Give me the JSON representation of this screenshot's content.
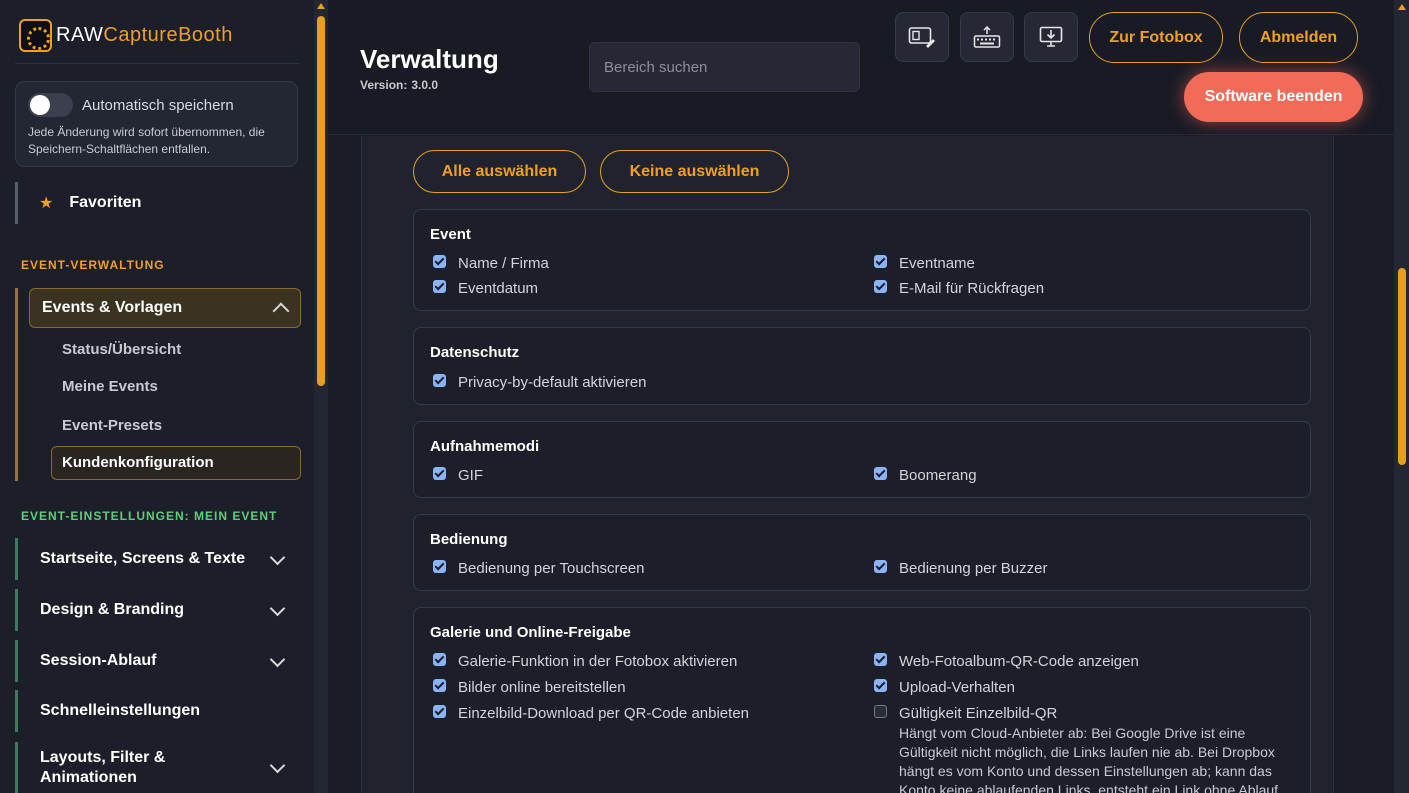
{
  "brand": {
    "raw": "RAW",
    "rest": "CaptureBooth",
    "accent": "#f0a020"
  },
  "autosave": {
    "label": "Automatisch speichern",
    "description": "Jede Änderung wird sofort übernommen, die Speichern-Schaltflächen entfallen.",
    "enabled": false
  },
  "favorites": {
    "label": "Favoriten",
    "icon": "star-icon"
  },
  "sidebar": {
    "section_event_management": "EVENT-VERWALTUNG",
    "events_group": {
      "label": "Events & Vorlagen",
      "items": [
        "Status/Übersicht",
        "Meine Events",
        "Event-Presets",
        "Kundenkonfiguration"
      ],
      "active": "Kundenkonfiguration"
    },
    "section_event_settings": "EVENT-EINSTELLUNGEN: MEIN EVENT",
    "settings_items": [
      {
        "label": "Startseite, Screens & Texte",
        "expandable": true
      },
      {
        "label": "Design & Branding",
        "expandable": true
      },
      {
        "label": "Session-Ablauf",
        "expandable": true
      },
      {
        "label": "Schnelleinstellungen",
        "expandable": false
      },
      {
        "label": "Layouts, Filter & Animationen",
        "expandable": true
      }
    ]
  },
  "header": {
    "title": "Verwaltung",
    "version_label": "Version:",
    "version": "3.0.0",
    "search_placeholder": "Bereich suchen",
    "icons": [
      "layout-edit-icon",
      "keyboard-icon",
      "monitor-download-icon"
    ],
    "to_photobox": "Zur Fotobox",
    "logout": "Abmelden",
    "quit": "Software beenden"
  },
  "main": {
    "select_all": "Alle auswählen",
    "select_none": "Keine auswählen",
    "groups": [
      {
        "title": "Event",
        "options": [
          {
            "label": "Name / Firma",
            "checked": true
          },
          {
            "label": "Eventname",
            "checked": true
          },
          {
            "label": "Eventdatum",
            "checked": true
          },
          {
            "label": "E-Mail für Rückfragen",
            "checked": true
          }
        ]
      },
      {
        "title": "Datenschutz",
        "options": [
          {
            "label": "Privacy-by-default aktivieren",
            "checked": true
          }
        ]
      },
      {
        "title": "Aufnahmemodi",
        "options": [
          {
            "label": "GIF",
            "checked": true
          },
          {
            "label": "Boomerang",
            "checked": true
          }
        ]
      },
      {
        "title": "Bedienung",
        "options": [
          {
            "label": "Bedienung per Touchscreen",
            "checked": true
          },
          {
            "label": "Bedienung per Buzzer",
            "checked": true
          }
        ]
      },
      {
        "title": "Galerie und Online-Freigabe",
        "options": [
          {
            "label": "Galerie-Funktion in der Fotobox aktivieren",
            "checked": true
          },
          {
            "label": "Web-Fotoalbum-QR-Code anzeigen",
            "checked": true
          },
          {
            "label": "Bilder online bereitstellen",
            "checked": true
          },
          {
            "label": "Upload-Verhalten",
            "checked": true
          },
          {
            "label": "Einzelbild-Download per QR-Code anbieten",
            "checked": true
          },
          {
            "label": "Gültigkeit Einzelbild-QR",
            "checked": false,
            "description": "Hängt vom Cloud-Anbieter ab: Bei Google Drive ist eine Gültigkeit nicht möglich, die Links laufen nie ab. Bei Dropbox hängt es vom Konto und dessen Einstellungen ab; kann das Konto keine ablaufenden Links, entsteht ein Link ohne Ablauf."
          }
        ]
      }
    ]
  }
}
